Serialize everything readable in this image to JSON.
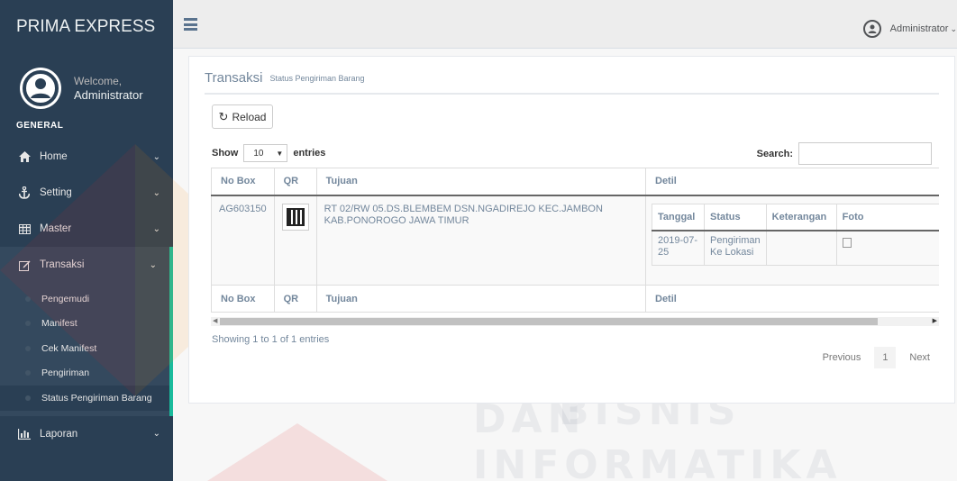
{
  "sidebar": {
    "brand": "PRIMA EXPRESS",
    "welcome": "Welcome,",
    "username": "Administrator",
    "section": "GENERAL",
    "items": [
      {
        "label": "Home",
        "icon": "home-icon"
      },
      {
        "label": "Setting",
        "icon": "anchor-icon"
      },
      {
        "label": "Master",
        "icon": "table-icon"
      },
      {
        "label": "Transaksi",
        "icon": "edit-icon"
      },
      {
        "label": "Laporan",
        "icon": "bar-chart-icon"
      }
    ],
    "submenu": [
      "Pengemudi",
      "Manifest",
      "Cek Manifest",
      "Pengiriman",
      "Status Pengiriman Barang"
    ]
  },
  "topbar": {
    "user": "Administrator"
  },
  "panel": {
    "title": "Transaksi",
    "subtitle": "Status Pengiriman Barang",
    "reload_label": "Reload",
    "show_label": "Show",
    "entries_value": "10",
    "entries_label": "entries",
    "search_label": "Search:",
    "search_value": ""
  },
  "table": {
    "headers": [
      "No Box",
      "QR",
      "Tujuan",
      "Detil"
    ],
    "rows": [
      {
        "no_box": "AG603150",
        "tujuan": "RT 02/RW 05.DS.BLEMBEM DSN.NGADIREJO KEC.JAMBON KAB.PONOROGO JAWA TIMUR",
        "detil_headers": [
          "Tanggal",
          "Status",
          "Keterangan",
          "Foto"
        ],
        "detil_rows": [
          {
            "tanggal": "2019-07-25",
            "status": "Pengiriman Ke Lokasi",
            "keterangan": ""
          }
        ]
      }
    ]
  },
  "footer": {
    "info": "Showing 1 to 1 of 1 entries",
    "previous": "Previous",
    "page": "1",
    "next": "Next"
  },
  "watermark": {
    "line1": "INSTITUT BISNIS",
    "line2": "DAN INFORMATIKA"
  },
  "colors": {
    "sidebar_bg": "#2a3f54",
    "accent": "#1abb9c",
    "topbar_bg": "#ededed"
  }
}
